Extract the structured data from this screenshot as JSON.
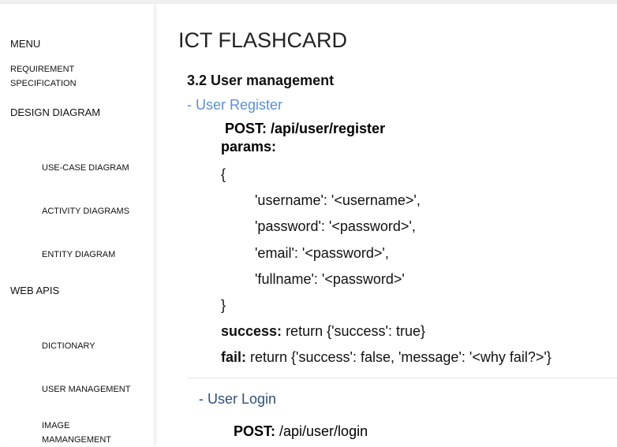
{
  "sidebar": {
    "menu": "MENU",
    "requirement_line1": "REQUIREMENT",
    "requirement_line2": "SPECIFICATION",
    "design_diagram": "DESIGN DIAGRAM",
    "use_case": "USE-CASE DIAGRAM",
    "activity": "ACTIVITY DIAGRAMS",
    "entity": "ENTITY DIAGRAM",
    "web_apis": "WEB APIS",
    "dictionary": "DICTIONARY",
    "user_management": "USER MANAGEMENT",
    "image_line1": "IMAGE",
    "image_line2": "MAMANGEMENT"
  },
  "main": {
    "title": "ICT FLASHCARD",
    "section": "3.2 User management",
    "register_link": "- User Register",
    "register_post": "POST: /api/user/register",
    "params_label": "params:",
    "brace_open": "{",
    "line_username": "'username': '<username>',",
    "line_password": "'password': '<password>',",
    "line_email": "'email': '<password>',",
    "line_fullname": "'fullname': '<password>'",
    "brace_close": "}",
    "success_label": "success:",
    "success_text": " return {'success': true}",
    "fail_label": "fail:",
    "fail_text": " return {'success': false, 'message': '<why fail?>'}",
    "login_link": "- User Login",
    "login_post_label": "POST:",
    "login_post_path": " /api/user/login"
  }
}
